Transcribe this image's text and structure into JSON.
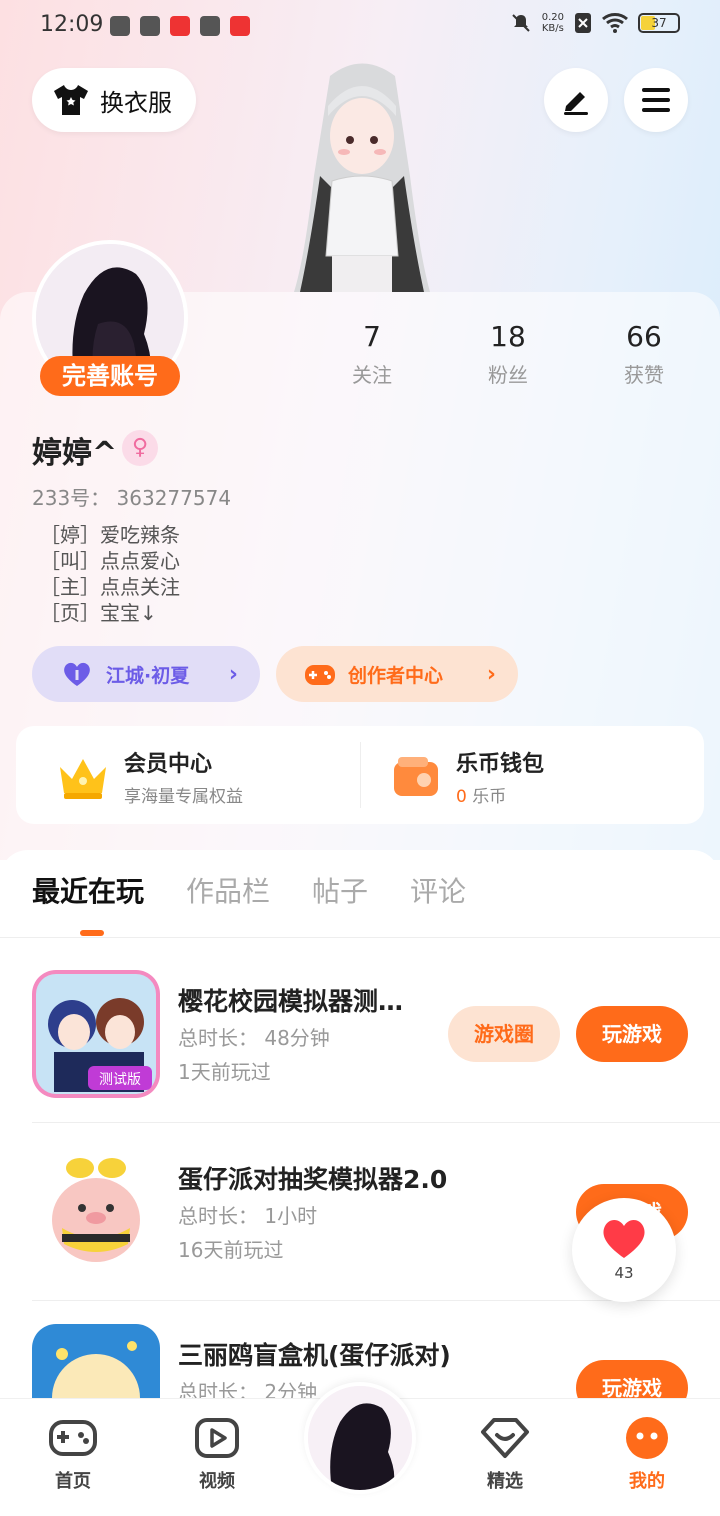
{
  "status_bar": {
    "time": "12:09",
    "net_speed": "0.20",
    "net_unit": "KB/s",
    "battery": "37"
  },
  "top": {
    "dress_label": "换衣服"
  },
  "profile": {
    "badge": "完善账号",
    "stats": [
      {
        "num": "7",
        "label": "关注"
      },
      {
        "num": "18",
        "label": "粉丝"
      },
      {
        "num": "66",
        "label": "获赞"
      }
    ],
    "name": "婷婷^",
    "gender_symbol": "♀",
    "uid": "233号： 363277574",
    "bio": [
      "［婷］爱吃辣条",
      "［叫］点点爱心",
      "［主］点点关注",
      "［页］宝宝↓"
    ],
    "guild": "江城·初夏",
    "creator": "创作者中心"
  },
  "vip": {
    "title": "会员中心",
    "sub": "享海量专属权益",
    "wallet_title": "乐币钱包",
    "wallet_amount": "0",
    "wallet_unit": "乐币"
  },
  "tabs": [
    "最近在玩",
    "作品栏",
    "帖子",
    "评论"
  ],
  "games": [
    {
      "title": "樱花校园模拟器测…",
      "duration": "总时长： 48分钟",
      "last": "1天前玩过",
      "circle_btn": "游戏圈",
      "play_btn": "玩游戏"
    },
    {
      "title": "蛋仔派对抽奖模拟器2.0",
      "duration": "总时长： 1小时",
      "last": "16天前玩过",
      "play_btn": "玩游戏"
    },
    {
      "title": "三丽鸥盲盒机(蛋仔派对)",
      "duration": "总时长： 2分钟",
      "play_btn": "玩游戏"
    }
  ],
  "like_count": "43",
  "nav": [
    {
      "label": "首页"
    },
    {
      "label": "视频"
    },
    {
      "label": "精选"
    },
    {
      "label": "我的"
    }
  ],
  "colors": {
    "accent": "#ff6b1a",
    "purple": "#6c5ce7"
  }
}
